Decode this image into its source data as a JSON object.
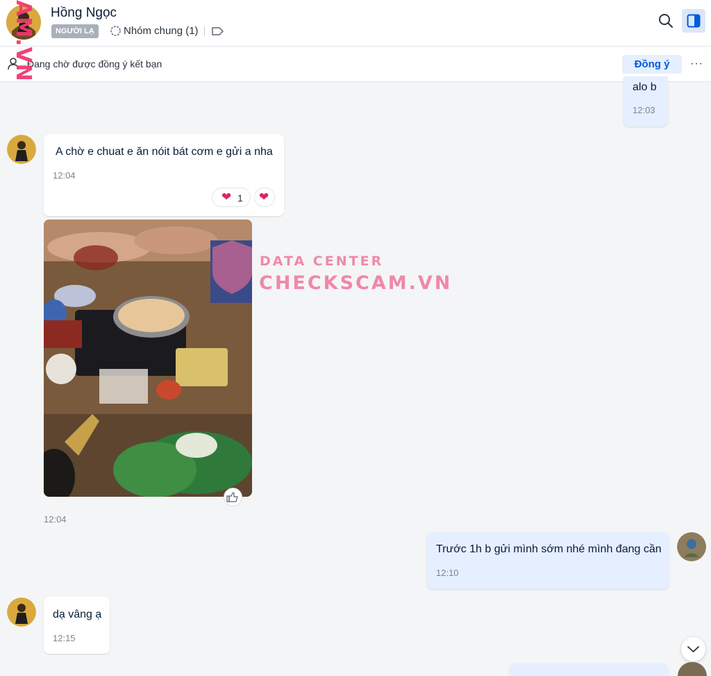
{
  "header": {
    "contact_name": "Hồng Ngọc",
    "stranger_badge": "NGƯỜI LẠ",
    "group_label": "Nhóm chung (1)",
    "icons": [
      "group-icon",
      "tag-icon",
      "search-icon",
      "sidebar-toggle-icon"
    ]
  },
  "pending": {
    "label": "Đang chờ được đồng ý kết bạn",
    "accept_label": "Đồng ý",
    "more_label": "···"
  },
  "watermark": {
    "side_text": "AM.VN",
    "line1": "DATA CENTER",
    "line2": "CHECKSCAM.VN"
  },
  "messages": [
    {
      "id": "m1",
      "sender": "me",
      "text": "alo b",
      "time": "12:03"
    },
    {
      "id": "m2",
      "sender": "contact",
      "text": "A chờ e chuat e ăn nóit bát cơm e gửi a nha",
      "time": "12:04",
      "reactions": [
        {
          "emoji": "❤️",
          "count": "1"
        },
        {
          "emoji": "❤️",
          "count": ""
        }
      ]
    },
    {
      "id": "m3",
      "sender": "contact",
      "type": "photo",
      "time": "12:04"
    },
    {
      "id": "m4",
      "sender": "me",
      "text": "Trước 1h b gửi mình sớm nhé mình đang cần",
      "time": "12:10"
    },
    {
      "id": "m5",
      "sender": "contact",
      "text": "dạ vâng ạ",
      "time": "12:15"
    }
  ],
  "colors": {
    "accent": "#005ae0",
    "my_bubble": "#e5efff",
    "background": "#f4f5f7",
    "watermark": "#f0396f"
  }
}
